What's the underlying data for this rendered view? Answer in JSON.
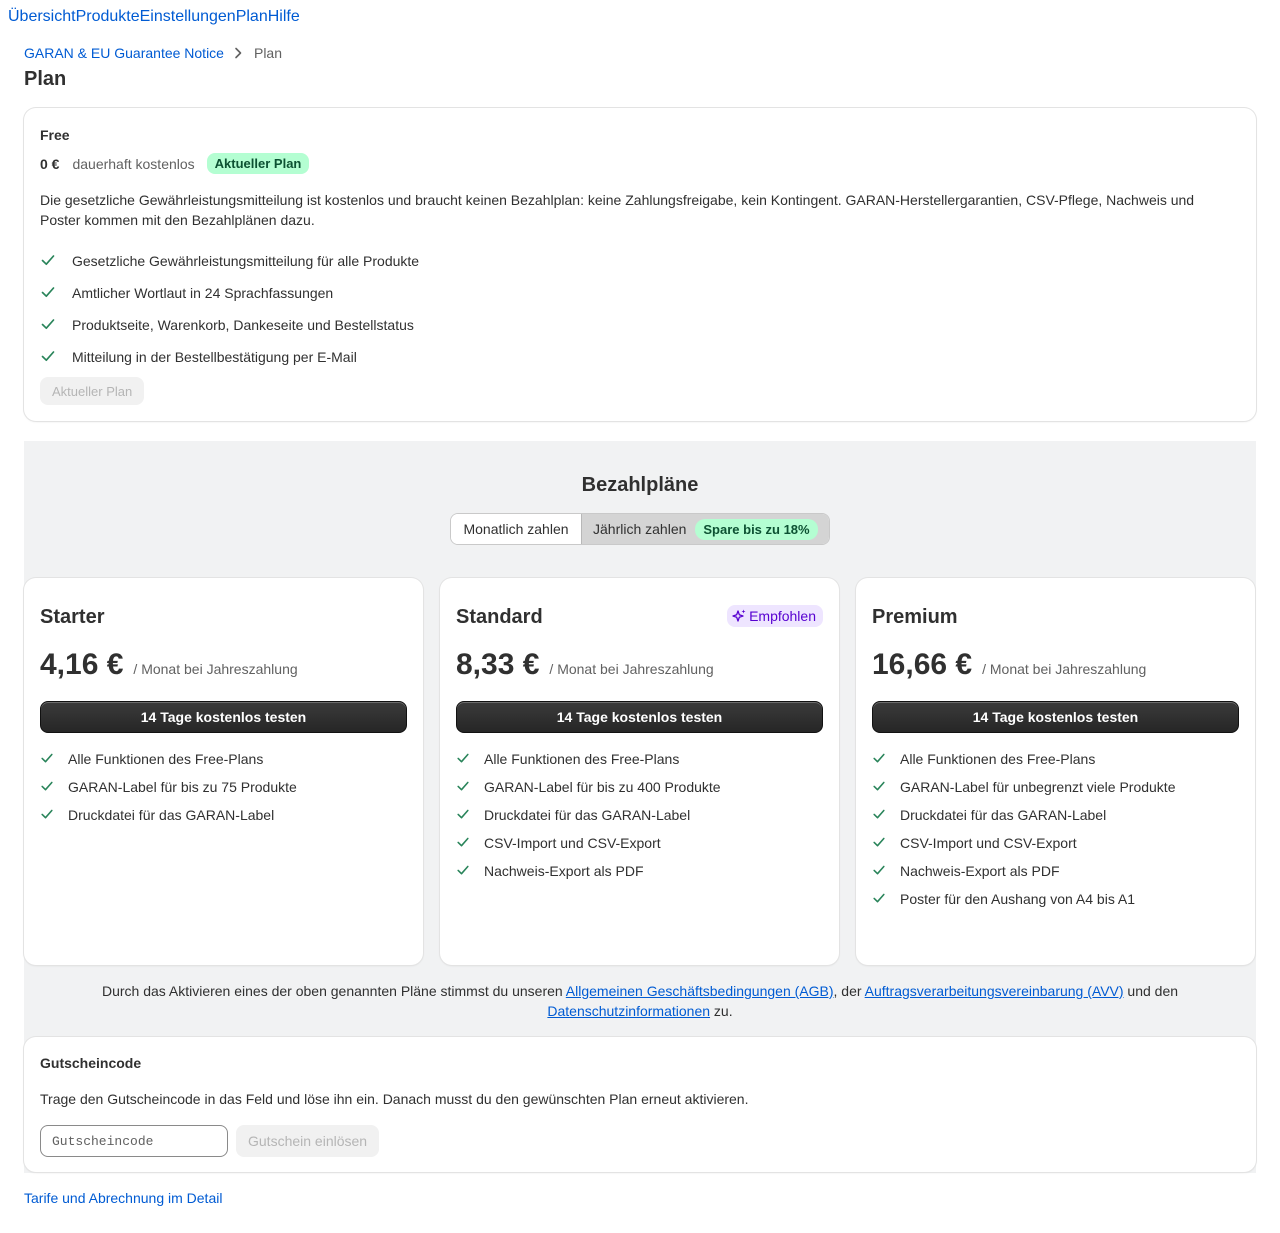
{
  "nav": {
    "items": [
      {
        "label": "Übersicht"
      },
      {
        "label": "Produkte"
      },
      {
        "label": "Einstellungen"
      },
      {
        "label": "Plan"
      },
      {
        "label": "Hilfe"
      }
    ]
  },
  "breadcrumb": {
    "parent": "GARAN & EU Guarantee Notice",
    "current": "Plan"
  },
  "page_title": "Plan",
  "free_plan": {
    "name": "Free",
    "price": "0 €",
    "price_note": "dauerhaft kostenlos",
    "badge": "Aktueller Plan",
    "description": "Die gesetzliche Gewährleistungsmitteilung ist kostenlos und braucht keinen Bezahlplan: keine Zahlungsfreigabe, kein Kontingent. GARAN-Herstellergarantien, CSV-Pflege, Nachweis und Poster kommen mit den Bezahlplänen dazu.",
    "features": [
      "Gesetzliche Gewährleistungsmitteilung für alle Produkte",
      "Amtlicher Wortlaut in 24 Sprachfassungen",
      "Produktseite, Warenkorb, Dankeseite und Bestellstatus",
      "Mitteilung in der Bestellbestätigung per E-Mail"
    ],
    "button_label": "Aktueller Plan"
  },
  "paid": {
    "title": "Bezahlpläne",
    "toggle": {
      "monthly_label": "Monatlich zahlen",
      "yearly_label": "Jährlich zahlen",
      "save_badge": "Spare bis zu 18%",
      "selected": "yearly"
    },
    "plans": [
      {
        "name": "Starter",
        "price": "4,16 €",
        "per": "/ Monat bei Jahreszahlung",
        "cta": "14 Tage kostenlos testen",
        "features": [
          "Alle Funktionen des Free-Plans",
          "GARAN-Label für bis zu 75 Produkte",
          "Druckdatei für das GARAN-Label"
        ]
      },
      {
        "name": "Standard",
        "price": "8,33 €",
        "per": "/ Monat bei Jahreszahlung",
        "cta": "14 Tage kostenlos testen",
        "badge": "Empfohlen",
        "features": [
          "Alle Funktionen des Free-Plans",
          "GARAN-Label für bis zu 400 Produkte",
          "Druckdatei für das GARAN-Label",
          "CSV-Import und CSV-Export",
          "Nachweis-Export als PDF"
        ]
      },
      {
        "name": "Premium",
        "price": "16,66 €",
        "per": "/ Monat bei Jahreszahlung",
        "cta": "14 Tage kostenlos testen",
        "features": [
          "Alle Funktionen des Free-Plans",
          "GARAN-Label für unbegrenzt viele Produkte",
          "Druckdatei für das GARAN-Label",
          "CSV-Import und CSV-Export",
          "Nachweis-Export als PDF",
          "Poster für den Aushang von A4 bis A1"
        ]
      }
    ],
    "terms": {
      "prefix": "Durch das Aktivieren eines der oben genannten Pläne stimmst du unseren ",
      "agb_link": "Allgemeinen Geschäftsbedingungen (AGB)",
      "mid1": ", der ",
      "avv_link": "Auftragsverarbeitungsvereinbarung (AVV)",
      "mid2": " und den ",
      "privacy_link": "Datenschutzinformationen",
      "suffix": " zu."
    }
  },
  "voucher": {
    "title": "Gutscheincode",
    "description": "Trage den Gutscheincode in das Feld und löse ihn ein. Danach musst du den gewünschten Plan erneut aktivieren.",
    "placeholder": "Gutscheincode",
    "button_label": "Gutschein einlösen"
  },
  "footer_link": "Tarife und Abrechnung im Detail",
  "colors": {
    "link": "#005bd3",
    "check": "#29845a",
    "badge_green_bg": "#b4fed2",
    "badge_purple_bg": "#eee5ff",
    "section_bg": "#f1f2f3"
  }
}
